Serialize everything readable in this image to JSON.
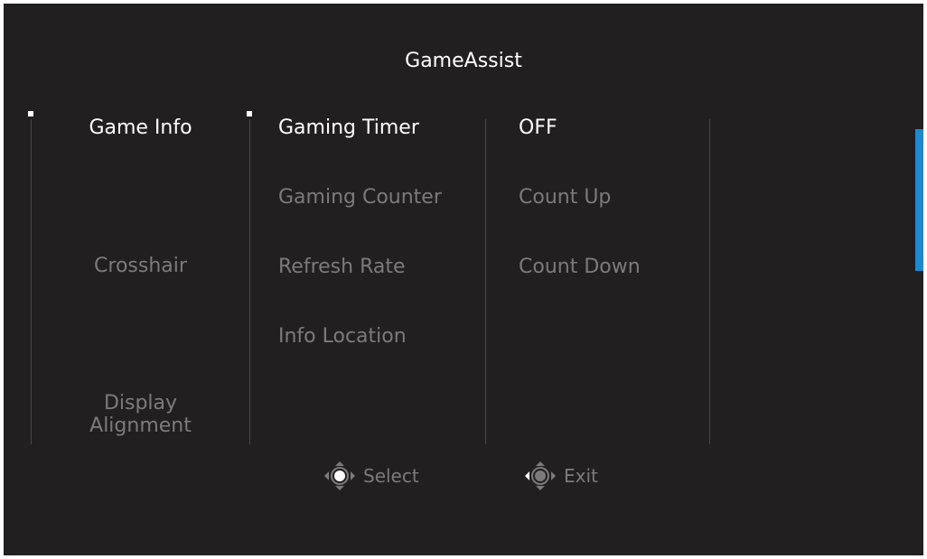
{
  "menu": {
    "title": "GameAssist",
    "categories": [
      {
        "label": "Game Info",
        "selected": true
      },
      {
        "label": "Crosshair",
        "selected": false
      },
      {
        "label": "Display Alignment",
        "line1": "Display",
        "line2": "Alignment",
        "selected": false
      }
    ],
    "options": [
      {
        "label": "Gaming Timer",
        "selected": true
      },
      {
        "label": "Gaming Counter",
        "selected": false
      },
      {
        "label": "Refresh Rate",
        "selected": false
      },
      {
        "label": "Info Location",
        "selected": false
      }
    ],
    "values": [
      {
        "label": "OFF",
        "selected": true
      },
      {
        "label": "Count Up",
        "selected": false
      },
      {
        "label": "Count Down",
        "selected": false
      }
    ]
  },
  "footer": {
    "select_label": "Select",
    "select_icon": "joystick-select-icon",
    "exit_label": "Exit",
    "exit_icon": "joystick-left-icon"
  },
  "colors": {
    "background": "#221f20",
    "active_text": "#ffffff",
    "inactive_text": "#7d7a7b",
    "divider": "#4a4748",
    "scrollbar": "#1e88d0"
  }
}
